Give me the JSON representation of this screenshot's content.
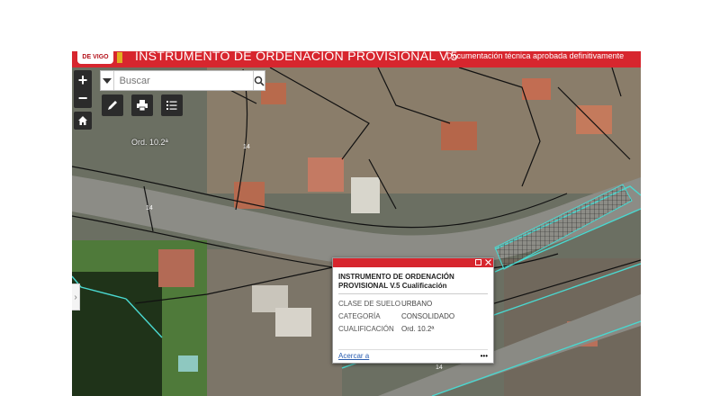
{
  "header": {
    "logo_text": "DE VIGO",
    "title": "INSTRUMENTO DE ORDENACIÓN PROVISIONAL V.5",
    "documentation": "Documentación técnica aprobada definitivamente"
  },
  "search": {
    "placeholder": "Buscar",
    "value": ""
  },
  "controls": {
    "zoom_in": "+",
    "zoom_out": "−",
    "icons": [
      "home-icon",
      "pencil-icon",
      "printer-icon",
      "list-icon",
      "search-icon",
      "caret-down-icon",
      "chevron-right-icon"
    ]
  },
  "map": {
    "ord_label": "Ord. 10.2ª",
    "street_labels": [
      "14",
      "14",
      "14"
    ],
    "colors": {
      "brand_red": "#d7262e",
      "parcel_line": "#4ad8d0",
      "lot_line": "#111111"
    }
  },
  "sidebar_toggle": "›",
  "popup": {
    "title": "INSTRUMENTO DE ORDENACIÓN PROVISIONAL V.5 Cualificación",
    "rows": [
      {
        "key": "CLASE DE SUELO",
        "value": "URBANO"
      },
      {
        "key": "CATEGORÍA",
        "value": "CONSOLIDADO"
      },
      {
        "key": "CUALIFICACIÓN",
        "value": "Ord. 10.2ª"
      }
    ],
    "zoom_link": "Acercar a",
    "more": "•••"
  }
}
